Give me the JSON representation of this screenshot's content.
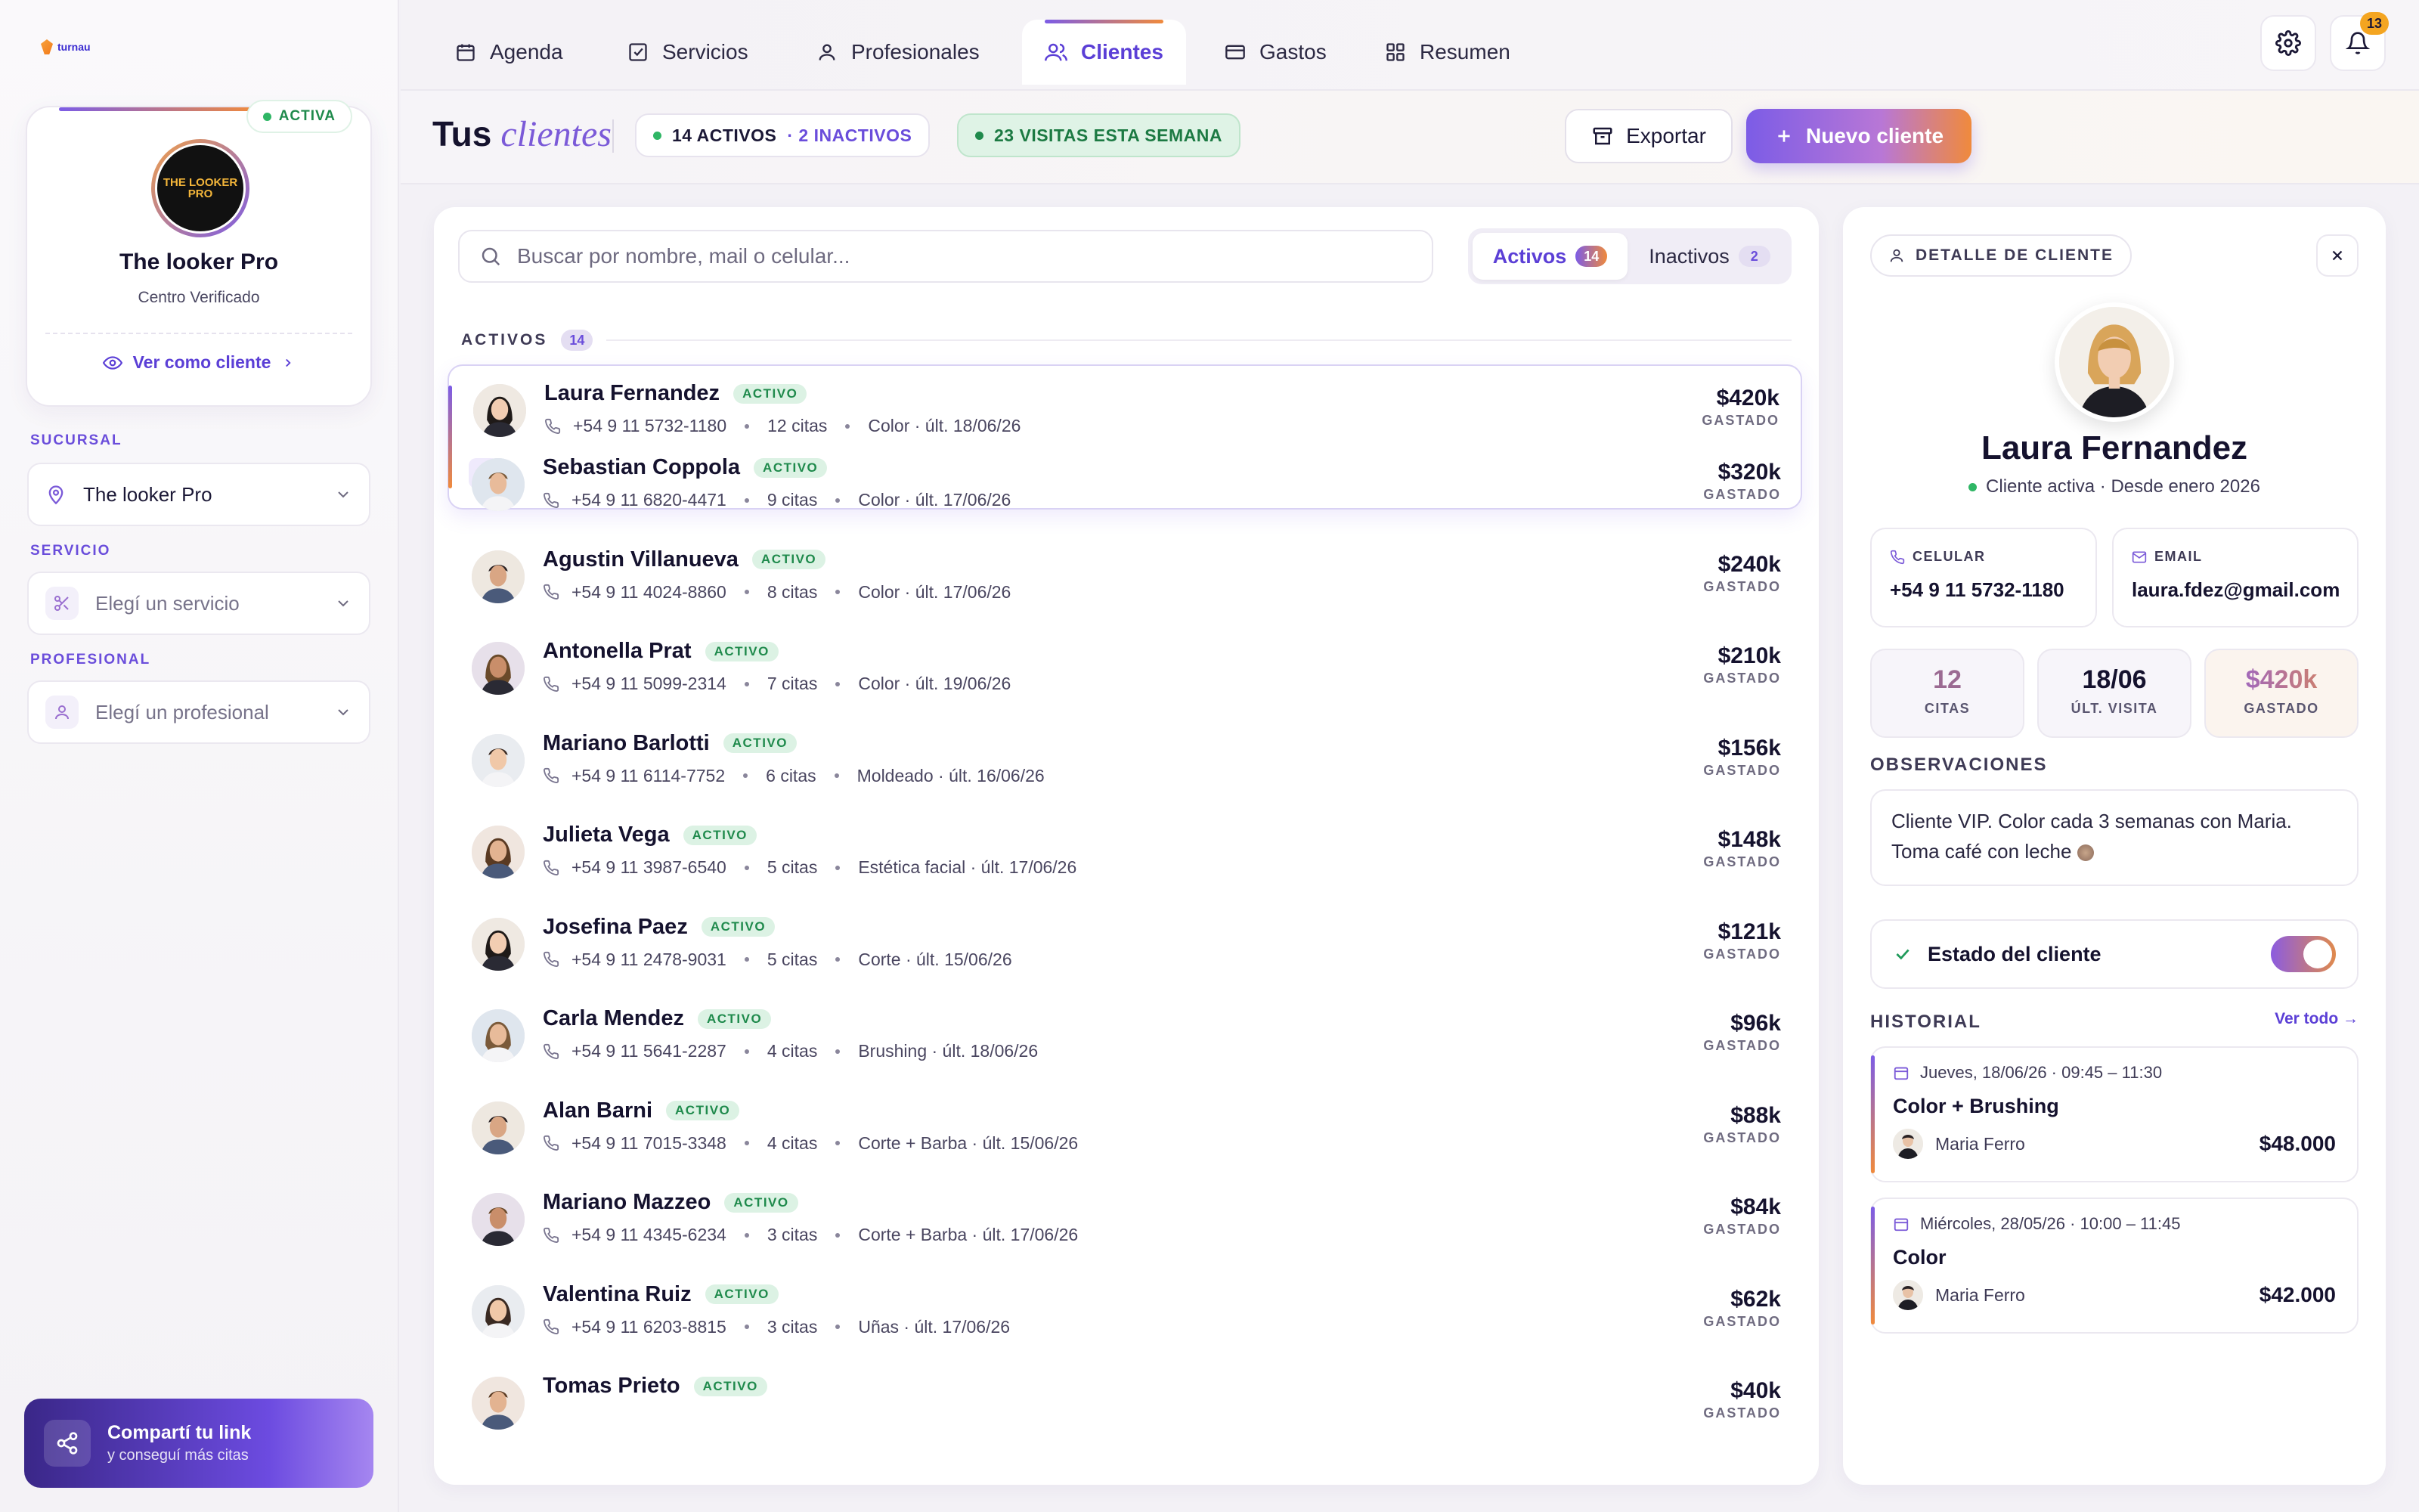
{
  "app": {
    "logo_text": "turnau"
  },
  "sidebar": {
    "center": {
      "status_badge": "ACTIVA",
      "logo_text": "THE LOOKER PRO",
      "name": "The looker Pro",
      "subtitle": "Centro Verificado",
      "view_as_client": "Ver como cliente"
    },
    "sucursal": {
      "label": "SUCURSAL",
      "value": "The looker Pro"
    },
    "servicio": {
      "label": "SERVICIO",
      "placeholder": "Elegí un servicio"
    },
    "profesional": {
      "label": "PROFESIONAL",
      "placeholder": "Elegí un profesional"
    },
    "share": {
      "title": "Compartí tu link",
      "subtitle": "y conseguí más citas"
    }
  },
  "nav": {
    "tabs": [
      {
        "label": "Agenda",
        "icon": "calendar-icon"
      },
      {
        "label": "Servicios",
        "icon": "checkbox-icon"
      },
      {
        "label": "Profesionales",
        "icon": "user-icon"
      },
      {
        "label": "Clientes",
        "icon": "users-icon",
        "active": true
      },
      {
        "label": "Gastos",
        "icon": "wallet-icon"
      },
      {
        "label": "Resumen",
        "icon": "grid-icon"
      }
    ],
    "notifications_count": "13"
  },
  "header": {
    "title_main": "Tus",
    "title_italic": "clientes",
    "active_count": "14 ACTIVOS",
    "inactive_count": "· 2 INACTIVOS",
    "visits": "23 VISITAS ESTA SEMANA",
    "export_label": "Exportar",
    "new_label": "Nuevo cliente"
  },
  "list": {
    "search_placeholder": "Buscar por nombre, mail o celular...",
    "filter_active_label": "Activos",
    "filter_active_count": "14",
    "filter_inactive_label": "Inactivos",
    "filter_inactive_count": "2",
    "section_label": "ACTIVOS",
    "section_count": "14",
    "status_label": "ACTIVO",
    "amount_label": "GASTADO",
    "clients": [
      {
        "name": "Laura Fernandez",
        "phone": "+54 9 11 5732-1180",
        "visits": "12 citas",
        "last": "Color · últ. 18/06/26",
        "amount": "$420k"
      },
      {
        "name": "Sebastian Coppola",
        "phone": "+54 9 11 6820-4471",
        "visits": "9 citas",
        "last": "Color · últ. 17/06/26",
        "amount": "$320k"
      },
      {
        "name": "Agustin Villanueva",
        "phone": "+54 9 11 4024-8860",
        "visits": "8 citas",
        "last": "Color · últ. 17/06/26",
        "amount": "$240k"
      },
      {
        "name": "Antonella Prat",
        "phone": "+54 9 11 5099-2314",
        "visits": "7 citas",
        "last": "Color · últ. 19/06/26",
        "amount": "$210k"
      },
      {
        "name": "Mariano Barlotti",
        "phone": "+54 9 11 6114-7752",
        "visits": "6 citas",
        "last": "Moldeado · últ. 16/06/26",
        "amount": "$156k"
      },
      {
        "name": "Julieta Vega",
        "phone": "+54 9 11 3987-6540",
        "visits": "5 citas",
        "last": "Estética facial · últ. 17/06/26",
        "amount": "$148k"
      },
      {
        "name": "Josefina Paez",
        "phone": "+54 9 11 2478-9031",
        "visits": "5 citas",
        "last": "Corte · últ. 15/06/26",
        "amount": "$121k"
      },
      {
        "name": "Carla Mendez",
        "phone": "+54 9 11 5641-2287",
        "visits": "4 citas",
        "last": "Brushing · últ. 18/06/26",
        "amount": "$96k"
      },
      {
        "name": "Alan Barni",
        "phone": "+54 9 11 7015-3348",
        "visits": "4 citas",
        "last": "Corte + Barba · últ. 15/06/26",
        "amount": "$88k"
      },
      {
        "name": "Mariano Mazzeo",
        "phone": "+54 9 11 4345-6234",
        "visits": "3 citas",
        "last": "Corte + Barba · últ. 17/06/26",
        "amount": "$84k"
      },
      {
        "name": "Valentina Ruiz",
        "phone": "+54 9 11 6203-8815",
        "visits": "3 citas",
        "last": "Uñas · últ. 17/06/26",
        "amount": "$62k"
      },
      {
        "name": "Tomas Prieto",
        "phone": "",
        "visits": "",
        "last": "",
        "amount": "$40k"
      }
    ]
  },
  "detail": {
    "chip": "DETALLE DE CLIENTE",
    "name": "Laura Fernandez",
    "status": "Cliente activa · Desde enero 2026",
    "phone_label": "CELULAR",
    "phone": "+54 9 11 5732-1180",
    "email_label": "EMAIL",
    "email": "laura.fdez@gmail.com",
    "stats": [
      {
        "value": "12",
        "label": "CITAS"
      },
      {
        "value": "18/06",
        "label": "ÚLT. VISITA"
      },
      {
        "value": "$420k",
        "label": "GASTADO"
      }
    ],
    "obs_label": "OBSERVACIONES",
    "obs_text": "Cliente VIP. Color cada 3 semanas con Maria. Toma café con leche",
    "estado_label": "Estado del cliente",
    "historial_label": "HISTORIAL",
    "ver_todo": "Ver todo →",
    "history": [
      {
        "date": "Jueves, 18/06/26 · 09:45 – 11:30",
        "service": "Color + Brushing",
        "pro": "Maria Ferro",
        "price": "$48.000"
      },
      {
        "date": "Miércoles, 28/05/26 · 10:00 – 11:45",
        "service": "Color",
        "pro": "Maria Ferro",
        "price": "$42.000"
      }
    ]
  }
}
